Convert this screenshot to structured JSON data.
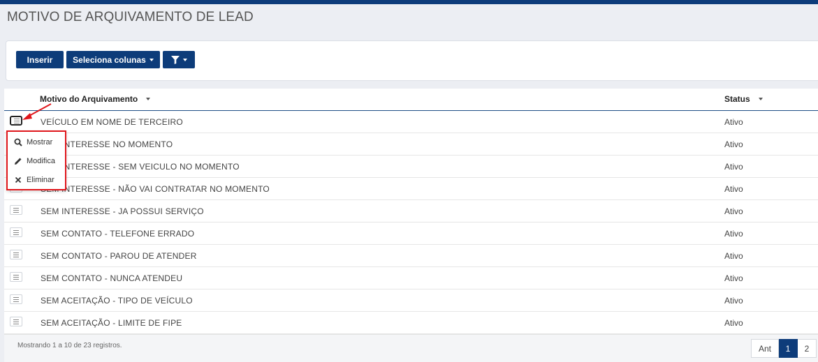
{
  "page": {
    "title": "MOTIVO DE ARQUIVAMENTO DE LEAD"
  },
  "toolbar": {
    "insert_label": "Inserir",
    "columns_label": "Seleciona colunas",
    "filter_icon": "funnel-icon"
  },
  "table": {
    "headers": {
      "motivo": "Motivo do Arquivamento",
      "status": "Status"
    },
    "rows": [
      {
        "motivo": "VEÍCULO EM NOME DE TERCEIRO",
        "status": "Ativo"
      },
      {
        "motivo": "SEM INTERESSE NO MOMENTO",
        "status": "Ativo"
      },
      {
        "motivo": "SEM INTERESSE - SEM VEICULO NO MOMENTO",
        "status": "Ativo"
      },
      {
        "motivo": "SEM INTERESSE - NÃO VAI CONTRATAR NO MOMENTO",
        "status": "Ativo"
      },
      {
        "motivo": "SEM INTERESSE - JA POSSUI SERVIÇO",
        "status": "Ativo"
      },
      {
        "motivo": "SEM CONTATO - TELEFONE ERRADO",
        "status": "Ativo"
      },
      {
        "motivo": "SEM CONTATO - PAROU DE ATENDER",
        "status": "Ativo"
      },
      {
        "motivo": "SEM CONTATO - NUNCA ATENDEU",
        "status": "Ativo"
      },
      {
        "motivo": "SEM ACEITAÇÃO - TIPO DE VEÍCULO",
        "status": "Ativo"
      },
      {
        "motivo": "SEM ACEITAÇÃO - LIMITE DE FIPE",
        "status": "Ativo"
      }
    ]
  },
  "row_menu": {
    "items": [
      {
        "label": "Mostrar",
        "icon": "search-icon"
      },
      {
        "label": "Modifica",
        "icon": "pencil-icon"
      },
      {
        "label": "Eliminar",
        "icon": "close-icon"
      }
    ]
  },
  "footer": {
    "info": "Mostrando 1 a 10 de 23 registros."
  },
  "pagination": {
    "prev": "Ant",
    "pages": [
      "1",
      "2"
    ],
    "current": "1"
  },
  "colors": {
    "primary": "#0d3c7a",
    "highlight": "#e0161b"
  }
}
